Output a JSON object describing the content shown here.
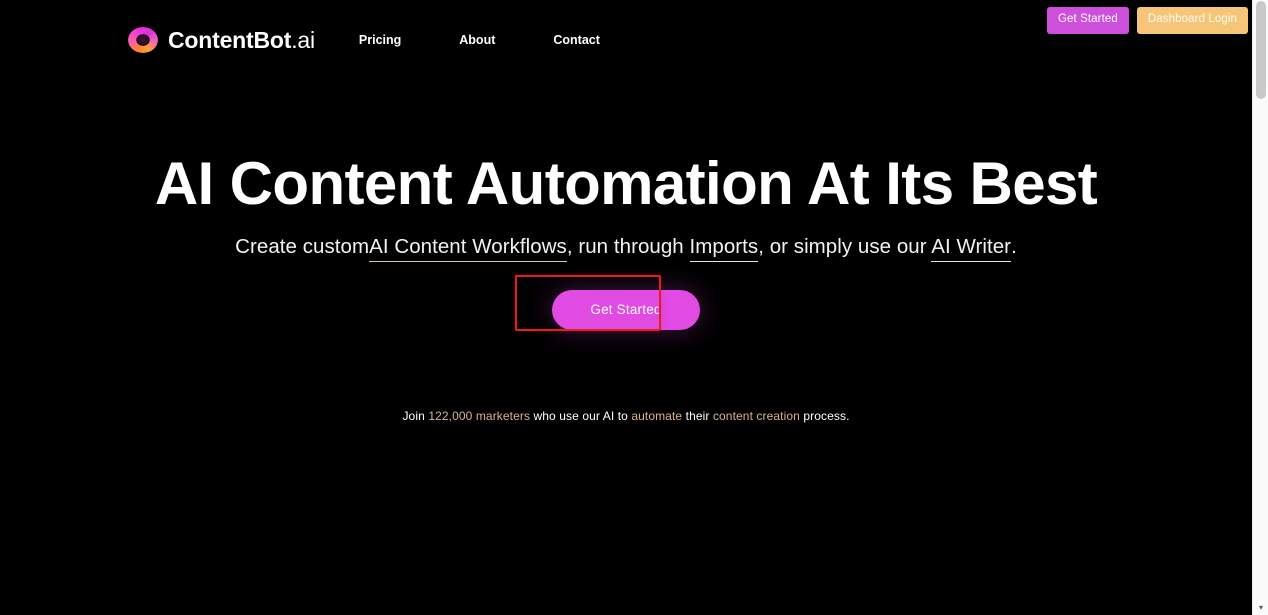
{
  "colors": {
    "background": "#000000",
    "accent_magenta": "#e24ae4",
    "accent_magenta_dark": "#cf4fdd",
    "accent_gold": "#f7c577",
    "accent_warm_text": "#d7b393",
    "annotation_red": "#e02020",
    "text_primary": "#ffffff"
  },
  "top_utility": {
    "get_started_label": "Get Started",
    "dashboard_login_label": "Dashboard Login"
  },
  "navbar": {
    "brand": {
      "name": "ContentBot",
      "suffix": ".ai",
      "logo_icon": "ring-gradient-icon"
    },
    "links": [
      {
        "label": "Pricing"
      },
      {
        "label": "About"
      },
      {
        "label": "Contact"
      }
    ]
  },
  "hero": {
    "title": "AI Content Automation At Its Best",
    "subheading": {
      "lead": "Create custom",
      "link_1": "AI Content Workflows",
      "mid_1": ", run through ",
      "link_2": "Imports",
      "mid_2": ", or simply use our ",
      "link_3": "AI Writer",
      "tail": "."
    },
    "cta_label": "Get Started",
    "social_proof": {
      "part_1": "Join ",
      "count_phrase": "122,000 marketers",
      "part_2": " who use our AI to ",
      "accent_2": "automate",
      "part_3": " their ",
      "accent_3": "content creation",
      "part_4": " process."
    }
  },
  "scrollbar": {
    "down_arrow_icon": "chevron-down-icon",
    "arrow_glyph": "▾"
  }
}
